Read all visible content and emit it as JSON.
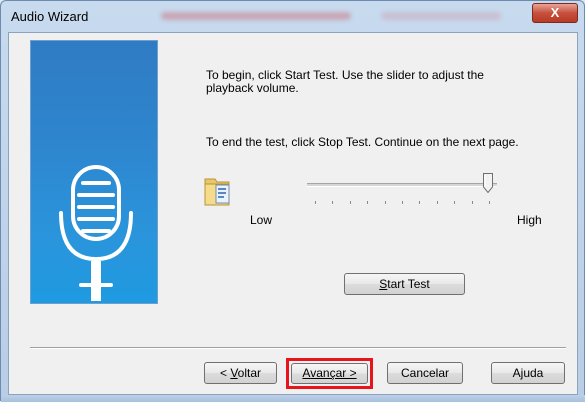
{
  "window": {
    "title": "Audio Wizard",
    "close_label": "X"
  },
  "instructions": {
    "line1": "To begin, click Start Test. Use the slider to adjust the",
    "line2": "playback volume.",
    "line3": "To end the test, click Stop Test. Continue on the next page."
  },
  "volume": {
    "low_label": "Low",
    "high_label": "High",
    "level": 0.95
  },
  "start_test": {
    "label": "Start Test",
    "mnemonic": "S",
    "rest": "tart Test"
  },
  "footer": {
    "back": {
      "label": "< Voltar",
      "prefix": "< ",
      "mnemonic": "V",
      "rest": "oltar"
    },
    "next": {
      "label": "Avançar >",
      "mnemonic": "A",
      "rest": "vançar >"
    },
    "cancel": {
      "label": "Cancelar"
    },
    "help": {
      "label": "Ajuda",
      "mnemonic": "j",
      "pre": "A",
      "rest": "uda"
    }
  },
  "colors": {
    "highlight": "#e8141b",
    "panel_blue": "#2e86cf"
  },
  "icons": [
    "close-icon",
    "microphone-icon",
    "speaker-folder-icon",
    "slider-thumb-icon"
  ]
}
